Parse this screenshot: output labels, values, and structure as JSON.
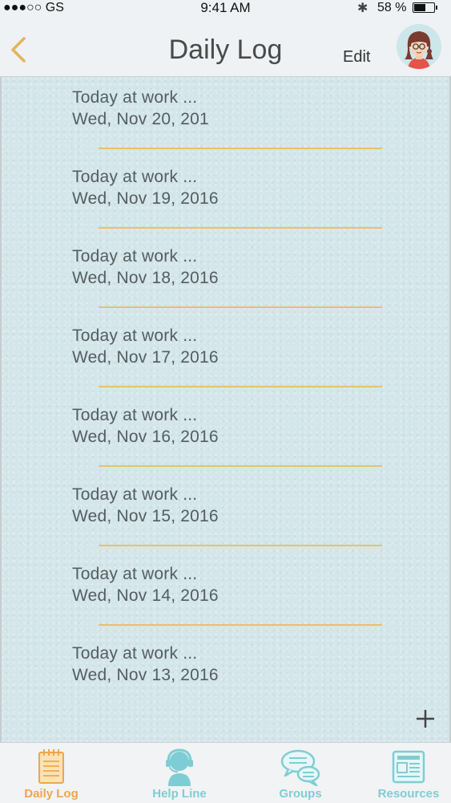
{
  "status_bar": {
    "carrier": "●●●○○ GS",
    "time": "9:41 AM",
    "battery": "58 %"
  },
  "nav": {
    "title": "Daily Log",
    "edit_label": "Edit"
  },
  "entries": [
    {
      "title": "Today at work ...",
      "date": "Wed, Nov 20, 201"
    },
    {
      "title": "Today at work ...",
      "date": "Wed, Nov 19, 2016"
    },
    {
      "title": "Today at work ...",
      "date": "Wed, Nov 18, 2016"
    },
    {
      "title": "Today at work ...",
      "date": "Wed, Nov 17, 2016"
    },
    {
      "title": "Today at work ...",
      "date": "Wed, Nov 16, 2016"
    },
    {
      "title": "Today at work ...",
      "date": "Wed, Nov 15, 2016"
    },
    {
      "title": "Today at work ...",
      "date": "Wed, Nov 14, 2016"
    },
    {
      "title": "Today at work ...",
      "date": "Wed, Nov 13, 2016"
    }
  ],
  "tabs": [
    {
      "label": "Daily Log",
      "icon": "notepad-icon",
      "active": true
    },
    {
      "label": "Help Line",
      "icon": "headset-person-icon",
      "active": false
    },
    {
      "label": "Groups",
      "icon": "chat-bubbles-icon",
      "active": false
    },
    {
      "label": "Resources",
      "icon": "newspaper-icon",
      "active": false
    }
  ],
  "colors": {
    "accent_active": "#f0a648",
    "accent_inactive": "#7fcdd4",
    "divider": "#e6c16f",
    "text": "#555d60",
    "background": "#d3e6ea"
  }
}
